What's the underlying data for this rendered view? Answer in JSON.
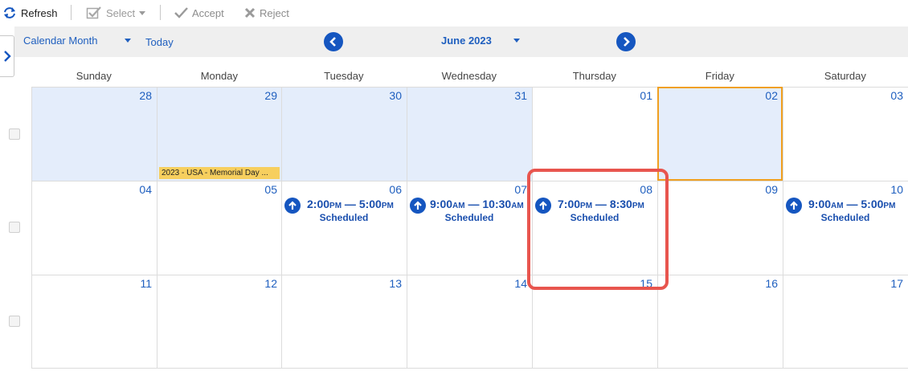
{
  "toolbar": {
    "refresh_label": "Refresh",
    "select_label": "Select",
    "accept_label": "Accept",
    "reject_label": "Reject"
  },
  "nav": {
    "view_label": "Calendar Month",
    "today_label": "Today",
    "month_label": "June 2023"
  },
  "weekdays": [
    "Sunday",
    "Monday",
    "Tuesday",
    "Wednesday",
    "Thursday",
    "Friday",
    "Saturday"
  ],
  "weeks": [
    [
      "28",
      "29",
      "30",
      "31",
      "01",
      "02",
      "03"
    ],
    [
      "04",
      "05",
      "06",
      "07",
      "08",
      "09",
      "10"
    ],
    [
      "11",
      "12",
      "13",
      "14",
      "15",
      "16",
      "17"
    ]
  ],
  "holiday": {
    "label": "2023 - USA - Memorial Day ..."
  },
  "events": [
    {
      "start": "2:00",
      "start_suffix": "PM",
      "end": "5:00",
      "end_suffix": "PM",
      "status": "Scheduled"
    },
    {
      "start": "9:00",
      "start_suffix": "AM",
      "end": "10:30",
      "end_suffix": "AM",
      "status": "Scheduled"
    },
    {
      "start": "7:00",
      "start_suffix": "PM",
      "end": "8:30",
      "end_suffix": "PM",
      "status": "Scheduled"
    },
    {
      "start": "9:00",
      "start_suffix": "AM",
      "end": "5:00",
      "end_suffix": "PM",
      "status": "Scheduled"
    }
  ],
  "colors": {
    "accent_blue": "#1556c0",
    "link_blue": "#1f5fbf",
    "other_month_bg": "#e4edfb",
    "today_border": "#f0a020",
    "holiday_bg": "#f7cf5e",
    "highlight": "#e8554e"
  },
  "icons": {
    "refresh": "refresh-icon",
    "select": "checkbox-icon",
    "accept": "check-icon",
    "reject": "x-icon",
    "prev": "chevron-left-icon",
    "next": "chevron-right-icon",
    "event": "arrow-up-icon"
  }
}
